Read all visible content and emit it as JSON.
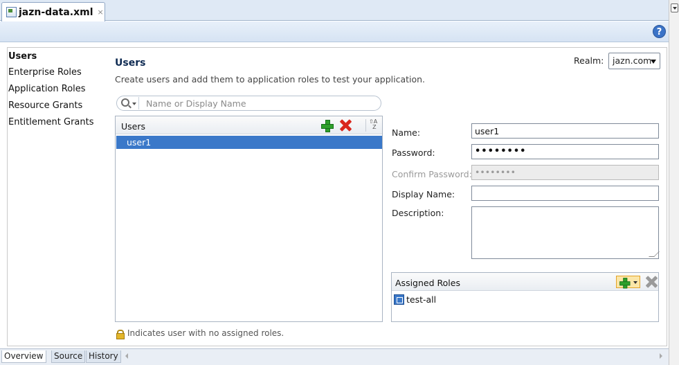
{
  "editor": {
    "file_tab": "jazn-data.xml",
    "close_glyph": "×",
    "help_glyph": "?"
  },
  "nav": {
    "items": [
      {
        "label": "Users",
        "active": true
      },
      {
        "label": "Enterprise Roles",
        "active": false
      },
      {
        "label": "Application Roles",
        "active": false
      },
      {
        "label": "Resource Grants",
        "active": false
      },
      {
        "label": "Entitlement Grants",
        "active": false
      }
    ]
  },
  "main": {
    "title": "Users",
    "description": "Create users and add them to application roles to test your application.",
    "realm_label": "Realm:",
    "realm_value": "jazn.com",
    "search_placeholder": "Name or Display Name"
  },
  "users_list": {
    "header": "Users",
    "rows": [
      "user1"
    ],
    "hint": "Indicates user with no assigned roles."
  },
  "form": {
    "name_label": "Name:",
    "name_value": "user1",
    "password_label": "Password:",
    "password_value": "••••••••",
    "confirm_label": "Confirm Password:",
    "confirm_value": "••••••••",
    "display_label": "Display Name:",
    "display_value": "",
    "description_label": "Description:"
  },
  "assigned_roles": {
    "header": "Assigned Roles",
    "items": [
      "test-all"
    ]
  },
  "bottom_tabs": [
    "Overview",
    "Source",
    "History"
  ],
  "colors": {
    "selection": "#3a78c9",
    "add_green": "#2fa02a",
    "delete_red": "#d9261c"
  }
}
